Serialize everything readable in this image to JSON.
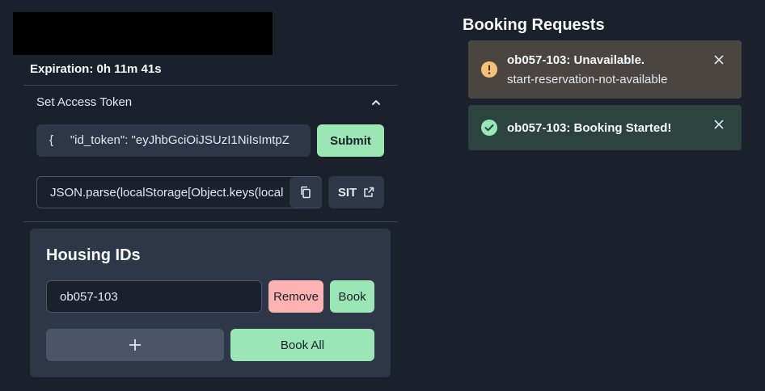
{
  "expiration": {
    "text": "Expiration: 0h 11m 41s"
  },
  "access_token": {
    "section_title": "Set Access Token",
    "token_value": "{     \"id_token\": \"eyJhbGciOiJSUzI1NiIsImtpZ",
    "submit_label": "Submit",
    "js_snippet": "JSON.parse(localStorage[Object.keys(local",
    "sit_label": "SIT"
  },
  "housing": {
    "title": "Housing IDs",
    "ids": [
      "ob057-103"
    ],
    "remove_label": "Remove",
    "book_label": "Book",
    "add_symbol": "+",
    "book_all_label": "Book All"
  },
  "requests": {
    "title": "Booking Requests",
    "toasts": [
      {
        "status": "warning",
        "title": "ob057-103: Unavailable.",
        "description": "start-reservation-not-available"
      },
      {
        "status": "success",
        "title": "ob057-103: Booking Started!"
      }
    ]
  },
  "colors": {
    "background": "#1a202c",
    "accent_green": "#9ae6b4",
    "accent_red": "#feb2b2",
    "warning": "#f6c177",
    "success": "#9ae6b4"
  },
  "icons": {
    "chevron": "chevron-up-icon",
    "copy": "copy-icon",
    "external_link": "external-link-icon",
    "warning": "warning-icon",
    "success": "check-circle-icon",
    "close": "close-icon",
    "add": "plus-icon"
  }
}
